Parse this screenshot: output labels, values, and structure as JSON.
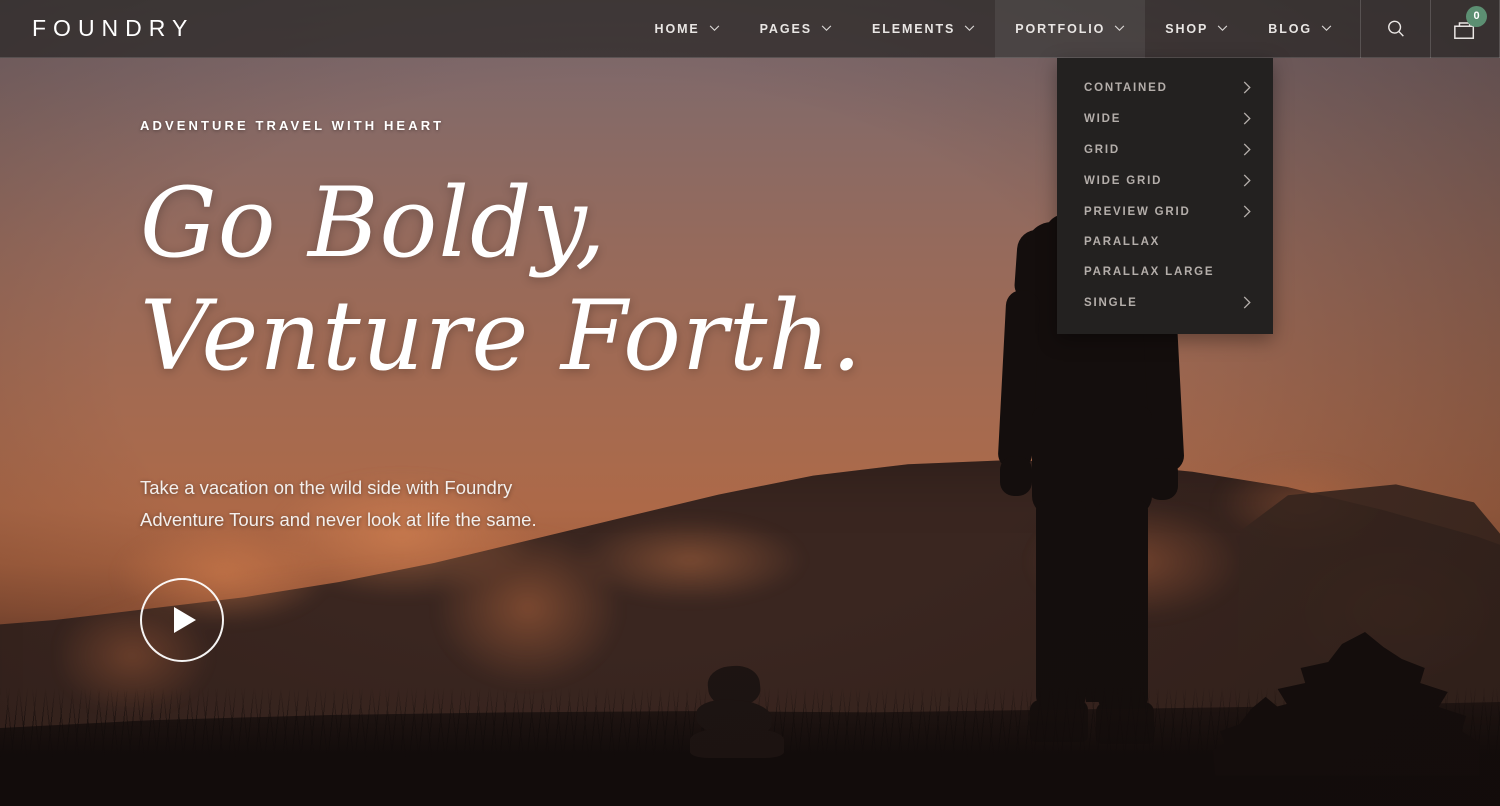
{
  "brand": {
    "logo": "FOUNDRY"
  },
  "header": {
    "nav": [
      {
        "label": "HOME",
        "icon": "chevron-down-icon",
        "active": false
      },
      {
        "label": "PAGES",
        "icon": "chevron-down-icon",
        "active": false
      },
      {
        "label": "ELEMENTS",
        "icon": "chevron-down-icon",
        "active": false
      },
      {
        "label": "PORTFOLIO",
        "icon": "chevron-down-icon",
        "active": true
      },
      {
        "label": "SHOP",
        "icon": "chevron-down-icon",
        "active": false
      },
      {
        "label": "BLOG",
        "icon": "chevron-down-icon",
        "active": false
      }
    ],
    "search_icon": "search-icon",
    "cart_icon": "shopping-bag-icon",
    "cart_count": "0",
    "cart_badge_color": "#5c8f72"
  },
  "dropdown": {
    "parent": "PORTFOLIO",
    "items": [
      {
        "label": "CONTAINED",
        "has_submenu": true
      },
      {
        "label": "WIDE",
        "has_submenu": true
      },
      {
        "label": "GRID",
        "has_submenu": true
      },
      {
        "label": "WIDE GRID",
        "has_submenu": true
      },
      {
        "label": "PREVIEW GRID",
        "has_submenu": true
      },
      {
        "label": "PARALLAX",
        "has_submenu": false
      },
      {
        "label": "PARALLAX LARGE",
        "has_submenu": false
      },
      {
        "label": "SINGLE",
        "has_submenu": true
      }
    ]
  },
  "hero": {
    "eyebrow": "ADVENTURE TRAVEL WITH HEART",
    "headline_line1": "Go Boldy,",
    "headline_line2": "Venture Forth.",
    "lede": "Take a vacation on the wild side with Foundry Adventure Tours and never look at life the same.",
    "play_button_icon": "play-icon"
  },
  "colors": {
    "sky_top": "#7d6d6a",
    "sky_glow": "#ad6948",
    "ground": "#140e0d",
    "header_bg": "rgba(40,38,37,.72)",
    "dropdown_bg": "#232120",
    "accent_badge": "#5c8f72"
  }
}
